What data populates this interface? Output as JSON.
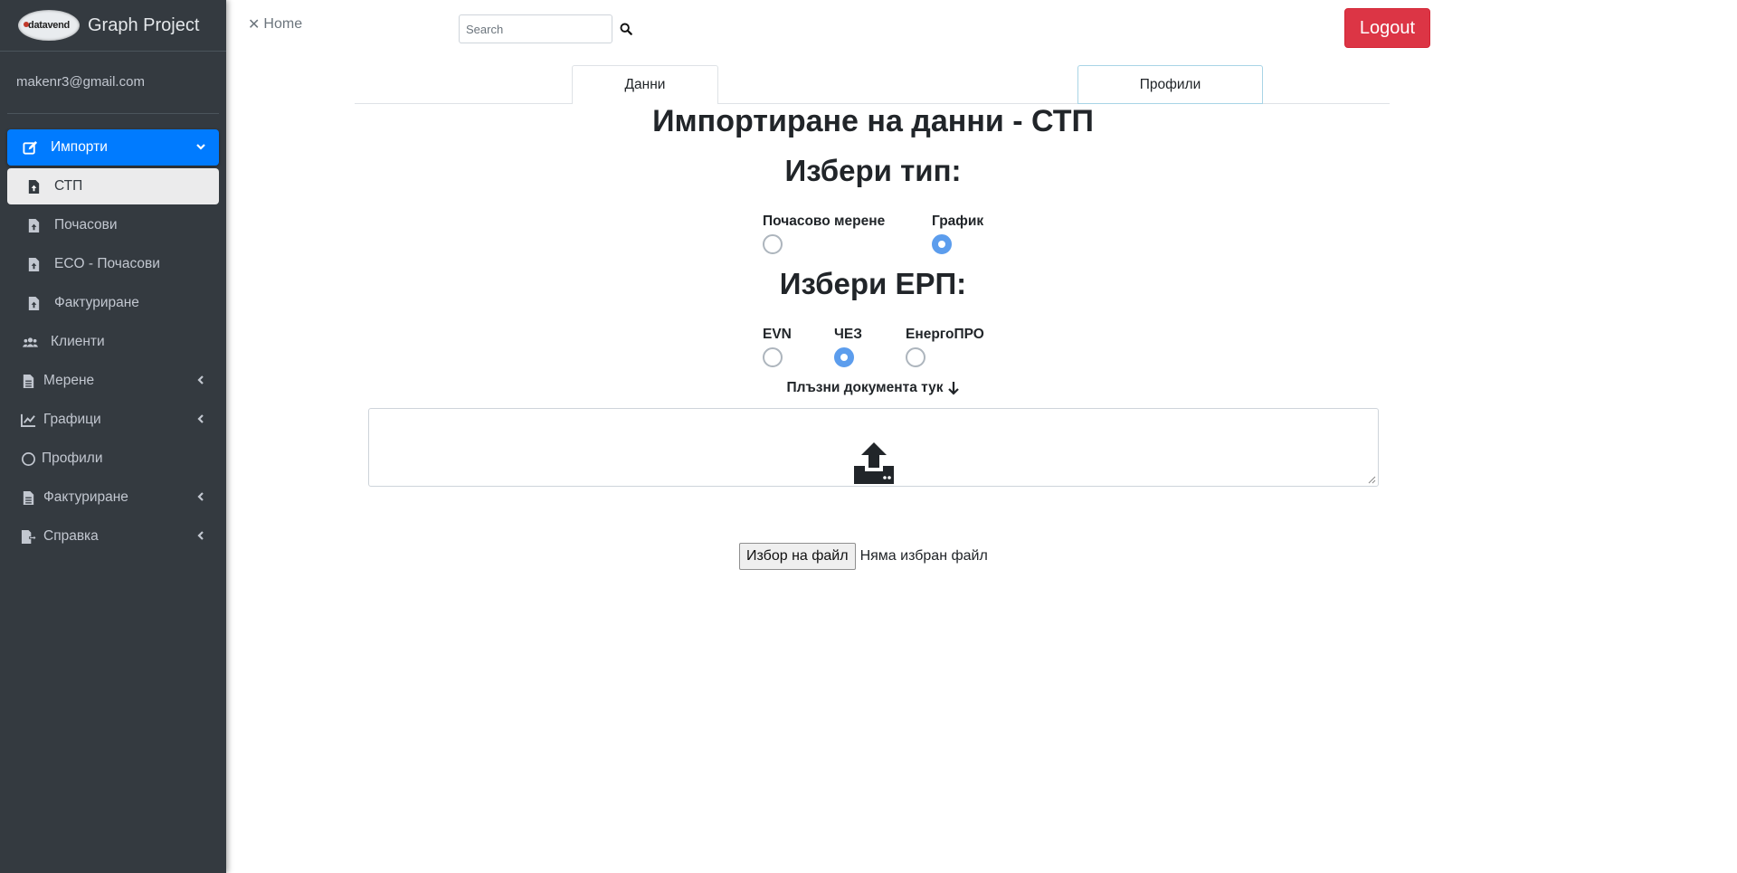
{
  "brand": {
    "logo_text": "datavend",
    "title": "Graph Project"
  },
  "user": {
    "email": "makenr3@gmail.com"
  },
  "sidebar": {
    "items": [
      {
        "label": "Импорти",
        "icon": "edit-icon",
        "state": "active",
        "arrow": "chevron-down-icon"
      },
      {
        "label": "СТП",
        "icon": "file-upload-icon",
        "state": "sub-active"
      },
      {
        "label": "Почасови",
        "icon": "file-upload-icon",
        "state": "sub"
      },
      {
        "label": "ECO - Почасови",
        "icon": "file-upload-icon",
        "state": "sub"
      },
      {
        "label": "Фактуриране",
        "icon": "file-upload-icon",
        "state": "sub"
      },
      {
        "label": "Клиенти",
        "icon": "users-icon",
        "state": "normal"
      },
      {
        "label": "Мерене",
        "icon": "file-icon",
        "state": "normal",
        "arrow": "chevron-left-icon"
      },
      {
        "label": "Графици",
        "icon": "chart-line-icon",
        "state": "normal",
        "arrow": "chevron-left-icon"
      },
      {
        "label": "Профили",
        "icon": "circle-icon",
        "state": "normal"
      },
      {
        "label": "Фактуриране",
        "icon": "file-icon",
        "state": "normal",
        "arrow": "chevron-left-icon"
      },
      {
        "label": "Справка",
        "icon": "sign-out-icon",
        "state": "normal",
        "arrow": "chevron-left-icon"
      }
    ]
  },
  "topbar": {
    "home_label": "Home",
    "search_placeholder": "Search",
    "logout_label": "Logout"
  },
  "tabs": {
    "data_label": "Данни",
    "profiles_label": "Профили"
  },
  "main": {
    "title": "Импортиране на данни - СТП",
    "type_heading": "Избери тип:",
    "type_options": [
      {
        "label": "Почасово мерене",
        "checked": false
      },
      {
        "label": "График",
        "checked": true
      }
    ],
    "erp_heading": "Избери ЕРП:",
    "erp_options": [
      {
        "label": "EVN",
        "checked": false
      },
      {
        "label": "ЧЕЗ",
        "checked": true
      },
      {
        "label": "ЕнергоПРО",
        "checked": false
      }
    ],
    "drop_label": "Плъзни документа тук",
    "file_button_label": "Избор на файл",
    "file_status": "Няма избран файл"
  },
  "colors": {
    "sidebar_bg": "#343a40",
    "active": "#007bff",
    "logout": "#dc3545",
    "radio_checked": "#5c9ded"
  }
}
